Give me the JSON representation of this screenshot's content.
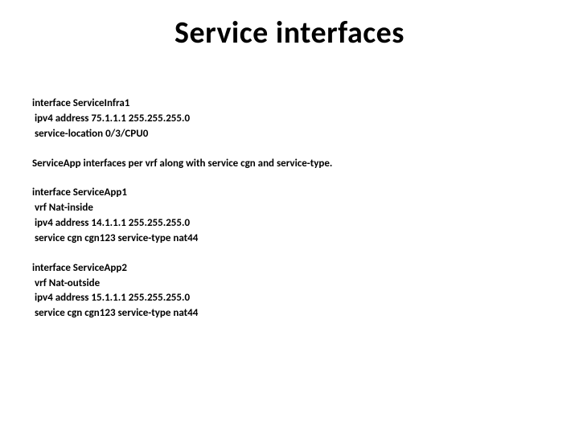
{
  "title": "Service interfaces",
  "blocks": {
    "infra": {
      "l1": "interface ServiceInfra1",
      "l2": " ipv4 address 75.1.1.1 255.255.255.0",
      "l3": " service-location 0/3/CPU0"
    },
    "note": "ServiceApp interfaces per vrf along with service cgn and service-type.",
    "app1": {
      "l1": "interface ServiceApp1",
      "l2": " vrf Nat-inside",
      "l3": " ipv4 address 14.1.1.1 255.255.255.0",
      "l4": " service cgn cgn123 service-type nat44"
    },
    "app2": {
      "l1": "interface ServiceApp2",
      "l2": " vrf Nat-outside",
      "l3": " ipv4 address 15.1.1.1 255.255.255.0",
      "l4": " service cgn cgn123 service-type nat44"
    }
  }
}
